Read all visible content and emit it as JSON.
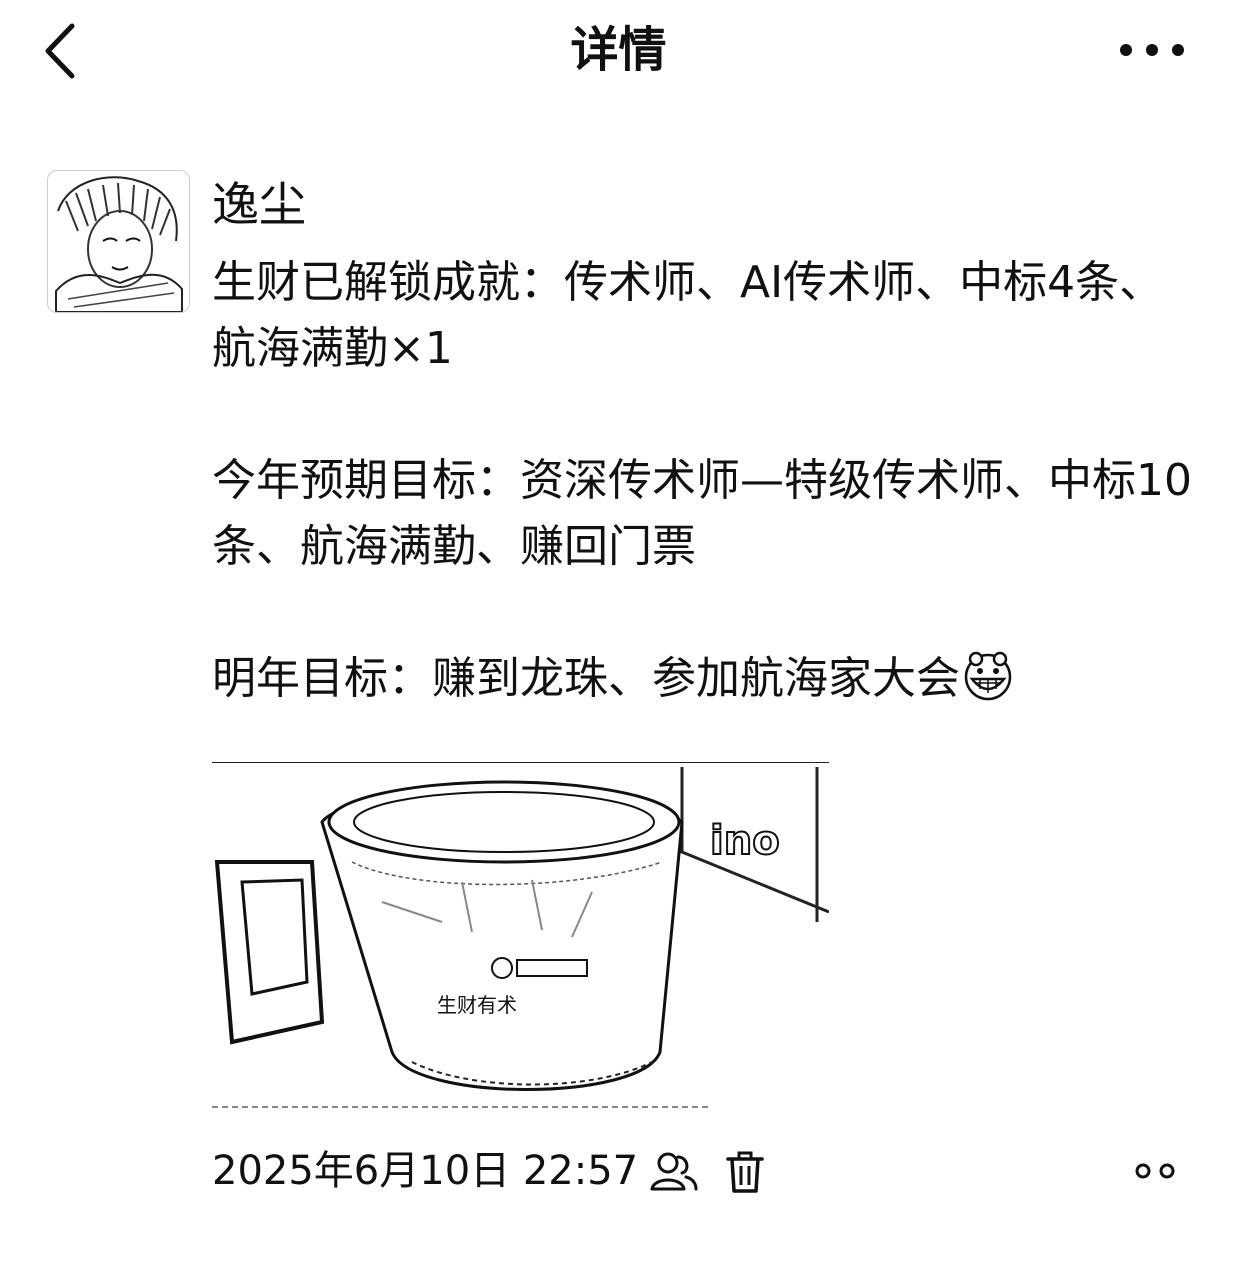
{
  "header": {
    "title": "详情"
  },
  "post": {
    "author": "逸尘",
    "paragraphs": [
      "生财已解锁成就：传术师、AI传术师、中标4条、航海满勤×1",
      "今年预期目标：资深传术师—特级传术师、中标10条、航海满勤、赚回门票",
      "明年目标：赚到龙珠、参加航海家大会"
    ],
    "emoji": "grinning-face-emoji",
    "image": {
      "printed_text": [
        "生财有术"
      ]
    },
    "timestamp": "2025年6月10日 22:57"
  },
  "icons": {
    "back": "chevron-left-icon",
    "more": "more-horizontal-icon",
    "privacy": "people-icon",
    "delete": "trash-icon",
    "comment": "comment-dots-icon"
  }
}
